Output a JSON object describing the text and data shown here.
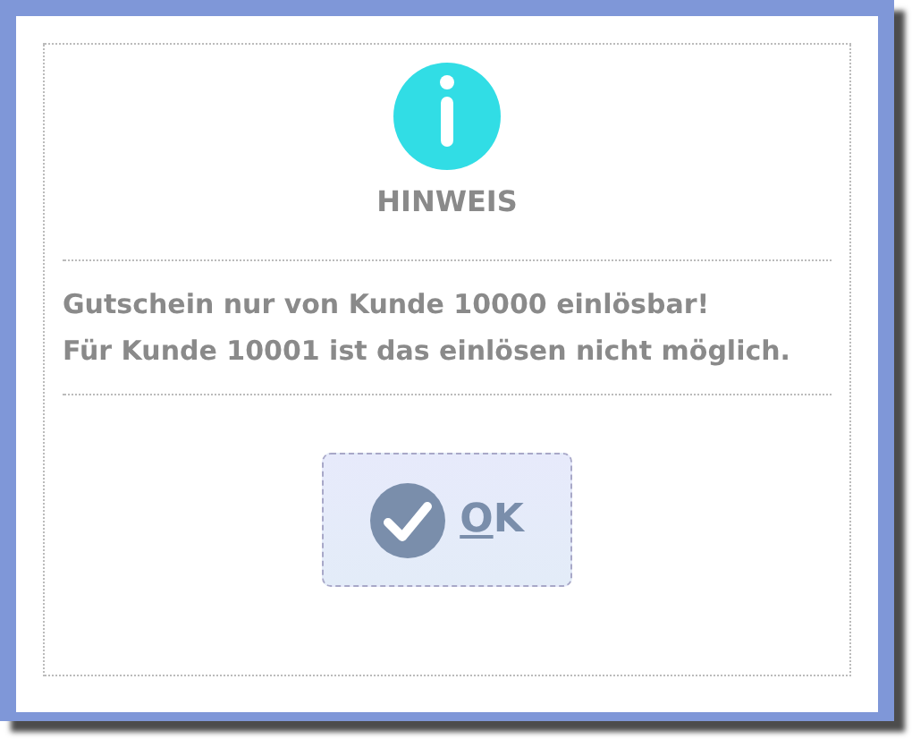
{
  "dialog": {
    "title": "HINWEIS",
    "message": [
      "Gutschein nur von Kunde 10000 einlösbar!",
      "Für Kunde 10001 ist das einlösen nicht möglich."
    ],
    "buttons": [
      {
        "label": "OK",
        "kind": "confirm"
      }
    ]
  }
}
